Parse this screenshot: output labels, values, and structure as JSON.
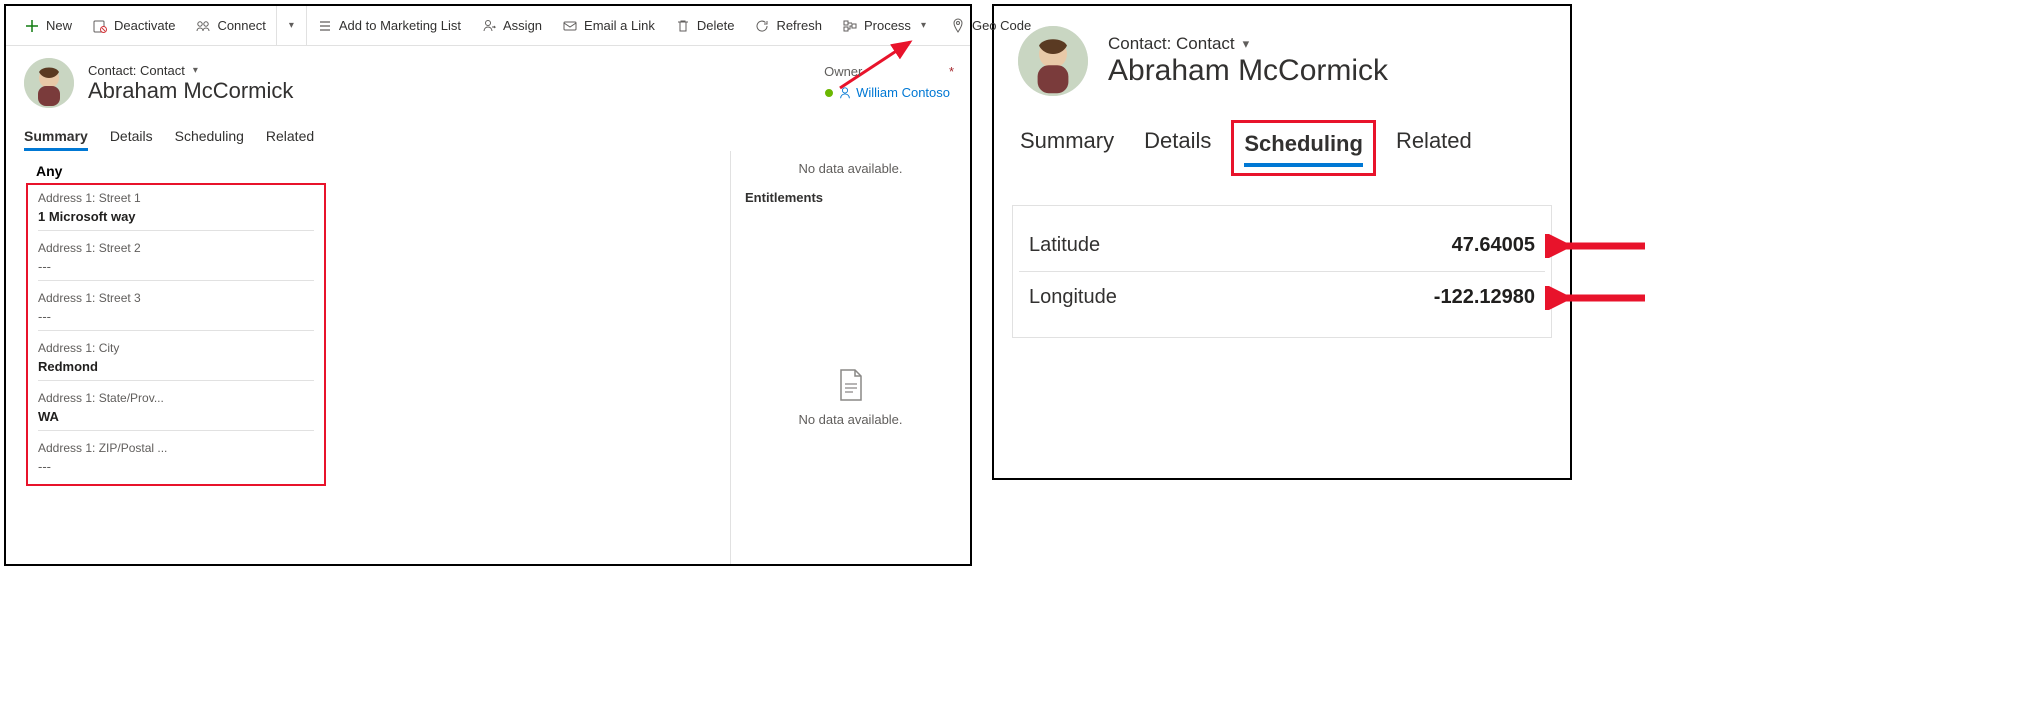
{
  "left": {
    "commands": {
      "new": "New",
      "deactivate": "Deactivate",
      "connect": "Connect",
      "add_marketing": "Add to Marketing List",
      "assign": "Assign",
      "email_link": "Email a Link",
      "delete": "Delete",
      "refresh": "Refresh",
      "process": "Process",
      "geocode": "Geo Code"
    },
    "entity_line": "Contact: Contact",
    "record_name": "Abraham McCormick",
    "owner": {
      "label": "Owner",
      "value": "William Contoso"
    },
    "tabs": [
      "Summary",
      "Details",
      "Scheduling",
      "Related"
    ],
    "active_tab": "Summary",
    "group_title": "Any",
    "fields": [
      {
        "label": "Address 1: Street 1",
        "value": "1 Microsoft way"
      },
      {
        "label": "Address 1: Street 2",
        "value": "---"
      },
      {
        "label": "Address 1: Street 3",
        "value": "---"
      },
      {
        "label": "Address 1: City",
        "value": "Redmond"
      },
      {
        "label": "Address 1: State/Prov...",
        "value": "WA"
      },
      {
        "label": "Address 1: ZIP/Postal ...",
        "value": "---"
      }
    ],
    "side": {
      "no_data": "No data available.",
      "entitlements": "Entitlements",
      "no_data2": "No data available."
    }
  },
  "right": {
    "entity_line": "Contact: Contact",
    "record_name": "Abraham McCormick",
    "tabs": [
      "Summary",
      "Details",
      "Scheduling",
      "Related"
    ],
    "active_tab": "Scheduling",
    "rows": [
      {
        "label": "Latitude",
        "value": "47.64005"
      },
      {
        "label": "Longitude",
        "value": "-122.12980"
      }
    ]
  }
}
